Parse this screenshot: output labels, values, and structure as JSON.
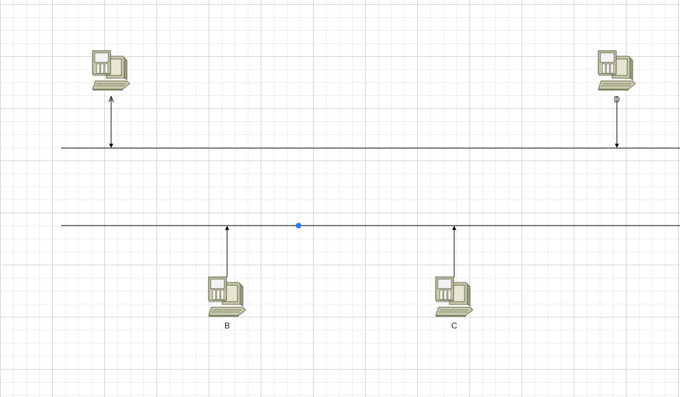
{
  "diagram": {
    "nodes": [
      {
        "id": "A",
        "label": "A"
      },
      {
        "id": "B",
        "label": "B"
      },
      {
        "id": "C",
        "label": "C"
      },
      {
        "id": "D",
        "label": "D"
      }
    ],
    "buses": [
      {
        "id": "upper-bus"
      },
      {
        "id": "lower-bus"
      }
    ],
    "connections": [
      {
        "from": "A",
        "to": "upper-bus"
      },
      {
        "from": "D",
        "to": "upper-bus"
      },
      {
        "from": "B",
        "to": "lower-bus"
      },
      {
        "from": "C",
        "to": "lower-bus"
      }
    ],
    "colors": {
      "line": "#000000",
      "grid_major": "#d6d6d6",
      "grid_minor": "#eeeeee",
      "selection_handle": "#1a7cff",
      "computer_body": "#c9c9ad",
      "computer_dark": "#7d7d62",
      "computer_screen": "#f2f2f2"
    },
    "icons": {
      "node": "desktop-computer-icon"
    }
  }
}
